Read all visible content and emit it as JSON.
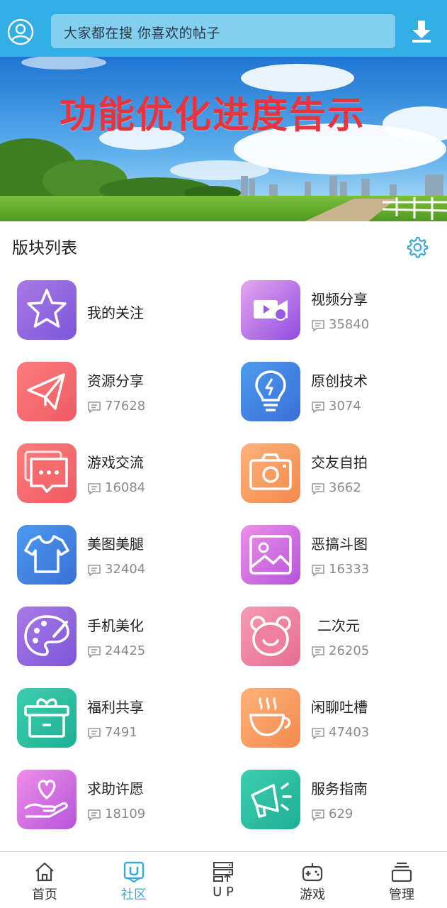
{
  "header": {
    "search_placeholder": "大家都在搜  你喜欢的帖子",
    "avatar_icon": "user-circle-icon",
    "download_icon": "download-icon",
    "bg_color": "#32aee4"
  },
  "banner": {
    "title": "功能优化进度告示"
  },
  "section": {
    "title": "版块列表",
    "settings_icon": "gear-icon"
  },
  "forums": [
    {
      "name": "我的关注",
      "count": "",
      "icon": "star-icon"
    },
    {
      "name": "视频分享",
      "count": "35840",
      "icon": "video-icon"
    },
    {
      "name": "资源分享",
      "count": "77628",
      "icon": "paper-plane-icon"
    },
    {
      "name": "原创技术",
      "count": "3074",
      "icon": "lightbulb-icon"
    },
    {
      "name": "游戏交流",
      "count": "16084",
      "icon": "chat-icon"
    },
    {
      "name": "交友自拍",
      "count": "3662",
      "icon": "camera-icon"
    },
    {
      "name": "美图美腿",
      "count": "32404",
      "icon": "tshirt-icon"
    },
    {
      "name": "恶搞斗图",
      "count": "16333",
      "icon": "image-icon"
    },
    {
      "name": "手机美化",
      "count": "24425",
      "icon": "palette-icon"
    },
    {
      "name": "二次元",
      "count": "26205",
      "icon": "bear-icon"
    },
    {
      "name": "福利共享",
      "count": "7491",
      "icon": "gift-box-icon"
    },
    {
      "name": "闲聊吐槽",
      "count": "47403",
      "icon": "coffee-cup-icon"
    },
    {
      "name": "求助许愿",
      "count": "18109",
      "icon": "heart-hand-icon"
    },
    {
      "name": "服务指南",
      "count": "629",
      "icon": "megaphone-icon"
    }
  ],
  "bottom_nav": [
    {
      "label": "首页",
      "icon": "home-icon",
      "active": false
    },
    {
      "label": "社区",
      "icon": "community-icon",
      "active": true
    },
    {
      "label": "U P",
      "icon": "server-upload-icon",
      "active": false
    },
    {
      "label": "游戏",
      "icon": "gamepad-icon",
      "active": false
    },
    {
      "label": "管理",
      "icon": "stack-icon",
      "active": false
    }
  ],
  "colors": {
    "accent": "#38a8dc",
    "count_gray": "#8a8a8a"
  }
}
